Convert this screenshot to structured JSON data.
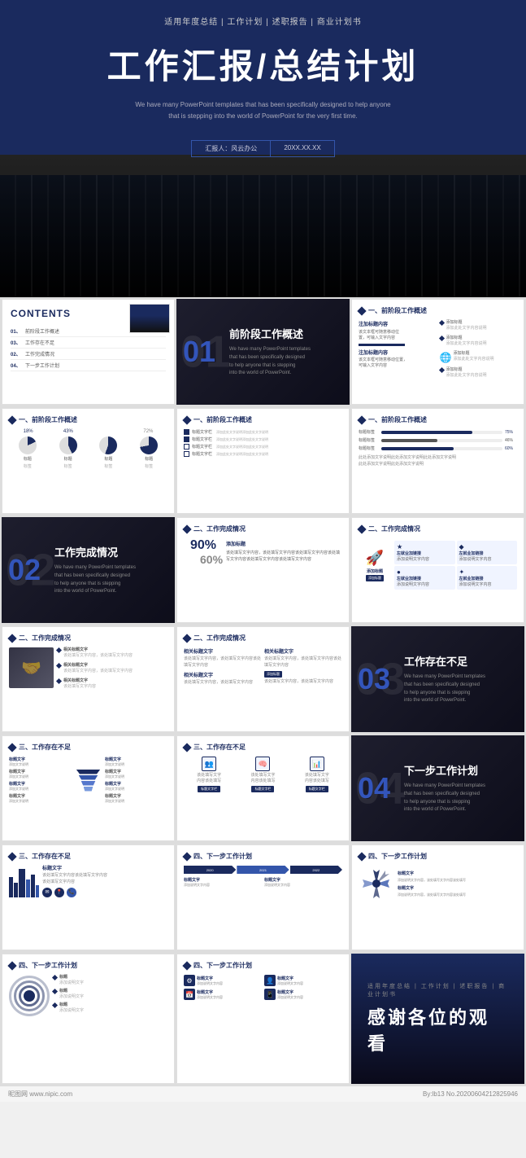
{
  "cover": {
    "subtitle": "适用年度总结 | 工作计划 | 述职报告 | 商业计划书",
    "title": "工作汇报/总结计划",
    "desc_line1": "We have many PowerPoint templates that has been specifically designed to help anyone",
    "desc_line2": "that is stepping into the world of PowerPoint for the very first time.",
    "presenter_label": "汇报人：风云办公",
    "date_label": "20XX.XX.XX"
  },
  "contents": {
    "title": "CONTENTS",
    "items": [
      {
        "num": "01、",
        "text": "前阶段工作概述"
      },
      {
        "num": "02、",
        "text": "工作完成情况"
      },
      {
        "num": "03、",
        "text": "工作存在不足"
      },
      {
        "num": "04、",
        "text": "下一步工作计划"
      }
    ]
  },
  "sections": [
    {
      "num": "01",
      "title": "前阶段工作概述"
    },
    {
      "num": "02",
      "title": "工作完成情况"
    },
    {
      "num": "03",
      "title": "工作存在不足"
    },
    {
      "num": "04",
      "title": "下一步工作计划"
    }
  ],
  "section_headers": [
    "一、前阶段工作概述",
    "二、工作完成情况",
    "三、工作存在不足",
    "四、下一步工作计划"
  ],
  "labels": {
    "title_label": "标题标签",
    "add_content": "添加标题",
    "text_content": "相关标题文字",
    "subtitle_label": "标题文字栏",
    "percentage_75": "75%",
    "percentage_46": "46%",
    "percentage_72": "72%",
    "percentage_90": "90%",
    "percentage_60": "60%"
  },
  "thankyou": {
    "subtitle": "适用年度总结 | 工作计划 | 述职报告 | 商业计划书",
    "title": "感谢各位的观看"
  },
  "watermark": {
    "nipic": "昵图网 www.nipic.com",
    "author": "By:lb13 No.20200604212825946"
  }
}
